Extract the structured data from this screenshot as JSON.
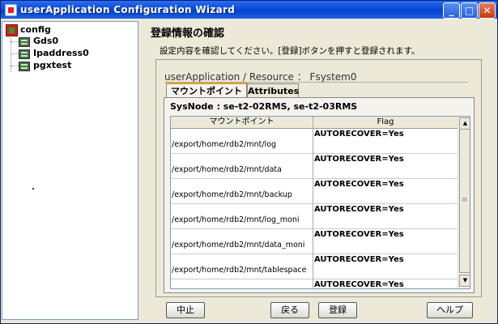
{
  "window": {
    "title": "userApplication Configuration Wizard"
  },
  "titlebar_buttons": {
    "minimize": "_",
    "maximize": "□",
    "close": "✕"
  },
  "tree": {
    "root": "config",
    "children": [
      "Gds0",
      "Ipaddress0",
      "pgxtest"
    ]
  },
  "main": {
    "title": "登録情報の確認",
    "instruction": "設定内容を確認してください。[登録]ボタンを押すと登録されます。",
    "ua_title": "userApplication / Resource  ：  Fsystem0",
    "tabs": [
      {
        "label": "マウントポイント",
        "active": true
      },
      {
        "label": "Attributes",
        "active": false
      }
    ],
    "sysnode": "SysNode : se-t2-02RMS, se-t2-03RMS",
    "table": {
      "columns": [
        "マウントポイント",
        "Flag"
      ],
      "rows": [
        {
          "path": "/export/home/rdb2/mnt/log",
          "flag": "AUTORECOVER=Yes"
        },
        {
          "path": "/export/home/rdb2/mnt/data",
          "flag": "AUTORECOVER=Yes"
        },
        {
          "path": "/export/home/rdb2/mnt/backup",
          "flag": "AUTORECOVER=Yes"
        },
        {
          "path": "/export/home/rdb2/mnt/log_moni",
          "flag": "AUTORECOVER=Yes"
        },
        {
          "path": "/export/home/rdb2/mnt/data_moni",
          "flag": "AUTORECOVER=Yes"
        },
        {
          "path": "/export/home/rdb2/mnt/tablespace",
          "flag": "AUTORECOVER=Yes"
        },
        {
          "path": "",
          "flag": "AUTORECOVER=Yes"
        }
      ]
    }
  },
  "buttons": {
    "cancel": "中止",
    "back": "戻る",
    "register": "登録",
    "help": "ヘルプ"
  },
  "scroll": {
    "up": "▲",
    "down": "▼"
  }
}
